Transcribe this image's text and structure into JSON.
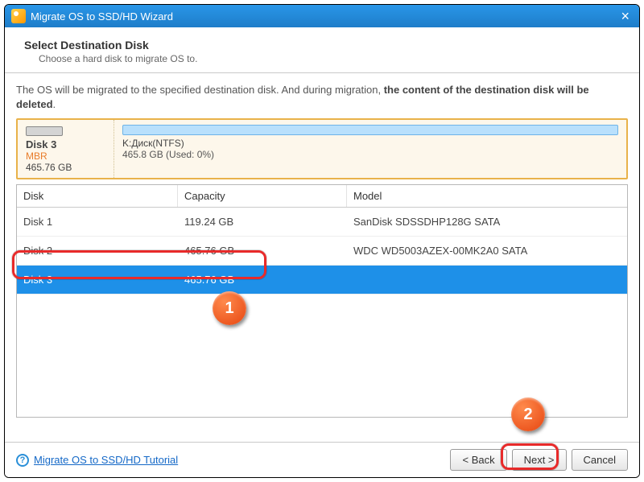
{
  "window": {
    "title": "Migrate OS to SSD/HD Wizard"
  },
  "header": {
    "title": "Select Destination Disk",
    "subtitle": "Choose a hard disk to migrate OS to."
  },
  "warning": {
    "pre": "The OS will be migrated to the specified destination disk. And during migration, ",
    "bold": "the content of the destination disk will be deleted"
  },
  "selected_disk": {
    "name": "Disk 3",
    "type": "MBR",
    "size": "465.76 GB",
    "partition_label": "K:Диск(NTFS)",
    "partition_size": "465.8 GB (Used: 0%)",
    "used_pct": 0
  },
  "columns": {
    "disk": "Disk",
    "capacity": "Capacity",
    "model": "Model"
  },
  "disks": [
    {
      "name": "Disk 1",
      "capacity": "119.24 GB",
      "model": "SanDisk SDSSDHP128G SATA",
      "selected": false
    },
    {
      "name": "Disk 2",
      "capacity": "465.76 GB",
      "model": "WDC WD5003AZEX-00MK2A0 SATA",
      "selected": false
    },
    {
      "name": "Disk 3",
      "capacity": "465.76 GB",
      "model": "",
      "selected": true
    }
  ],
  "footer": {
    "help_link": "Migrate OS to SSD/HD Tutorial",
    "back": "< Back",
    "next": "Next >",
    "cancel": "Cancel"
  },
  "annotations": {
    "label1": "1",
    "label2": "2"
  }
}
